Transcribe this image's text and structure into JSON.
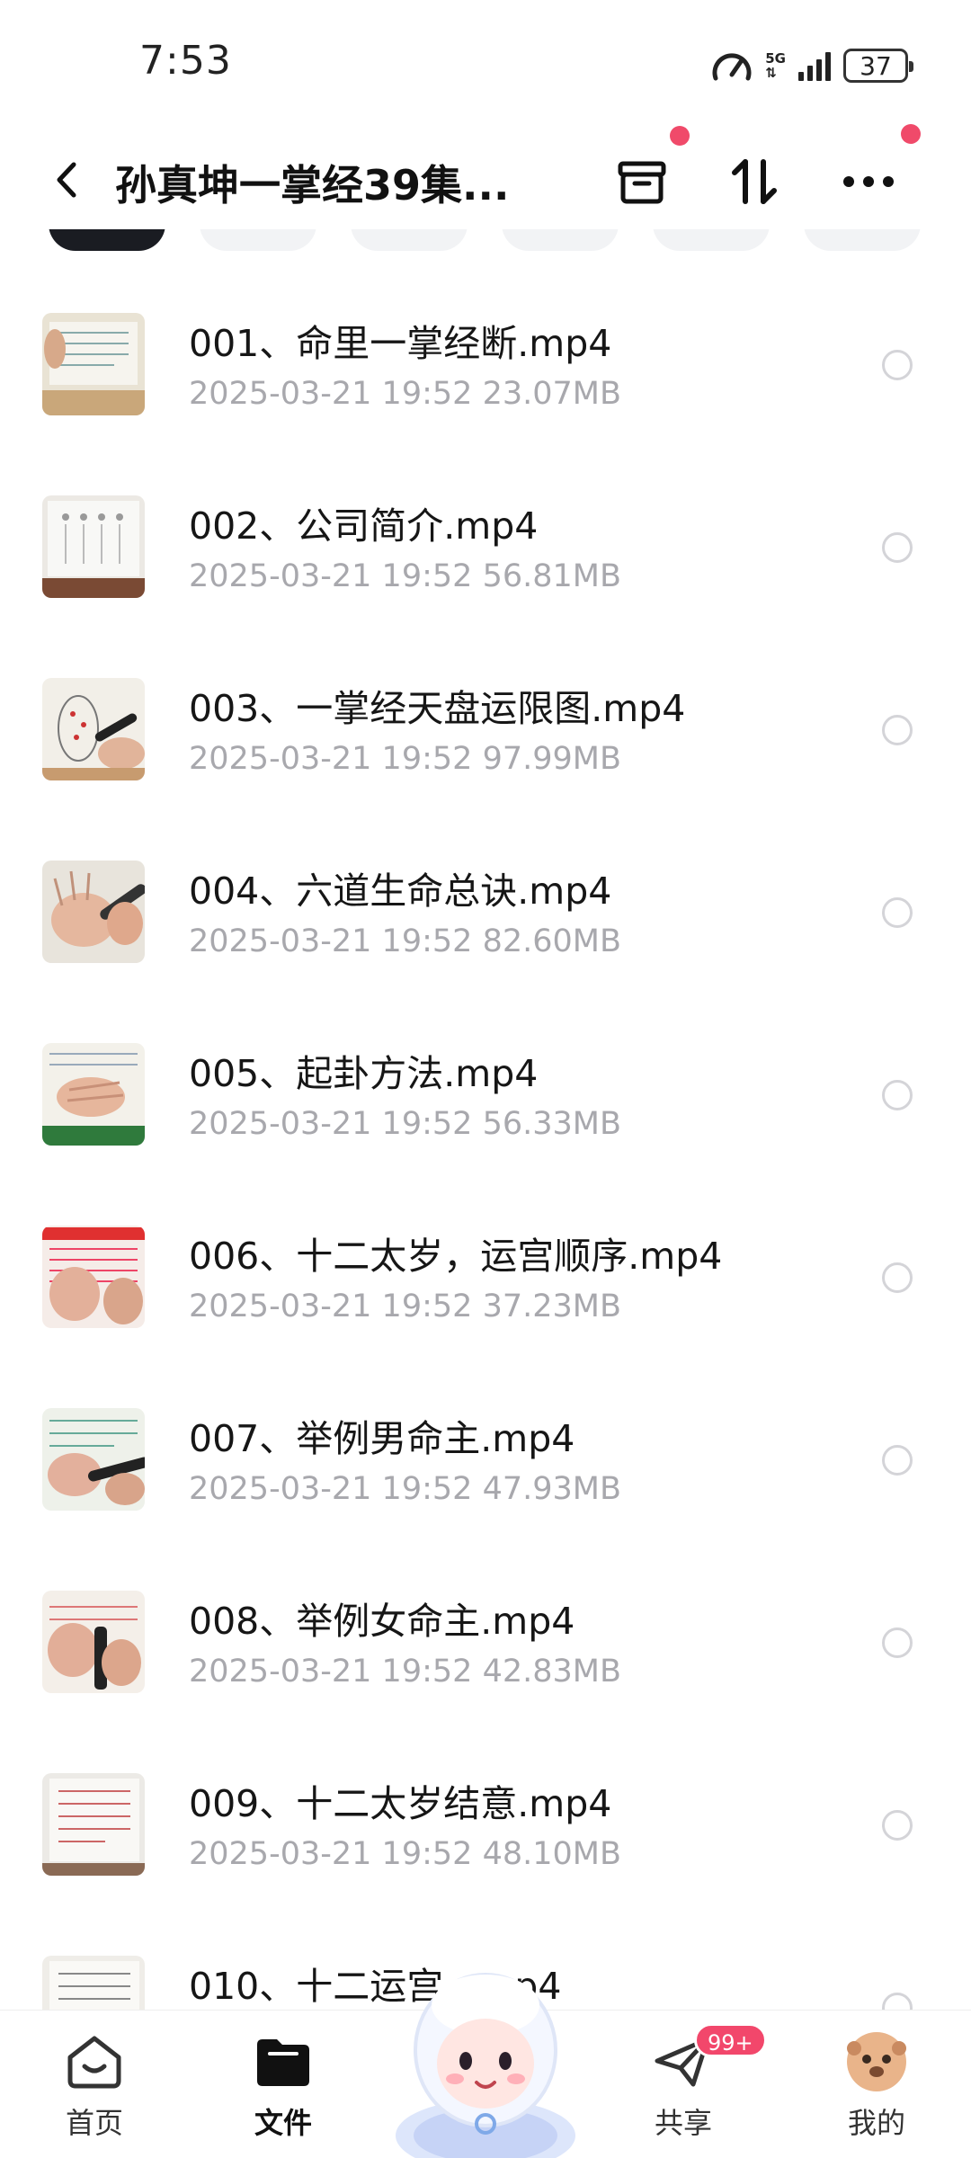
{
  "status_bar": {
    "time": "7:53",
    "network": "5G",
    "battery": "37"
  },
  "header": {
    "title": "孙真坤一掌经39集..."
  },
  "files": [
    {
      "name": "001、命里一掌经断.mp4",
      "date": "2025-03-21",
      "time": "19:52",
      "size": "23.07MB"
    },
    {
      "name": "002、公司简介.mp4",
      "date": "2025-03-21",
      "time": "19:52",
      "size": "56.81MB"
    },
    {
      "name": "003、一掌经天盘运限图.mp4",
      "date": "2025-03-21",
      "time": "19:52",
      "size": "97.99MB"
    },
    {
      "name": "004、六道生命总诀.mp4",
      "date": "2025-03-21",
      "time": "19:52",
      "size": "82.60MB"
    },
    {
      "name": "005、起卦方法.mp4",
      "date": "2025-03-21",
      "time": "19:52",
      "size": "56.33MB"
    },
    {
      "name": "006、十二太岁，运宫顺序.mp4",
      "date": "2025-03-21",
      "time": "19:52",
      "size": "37.23MB"
    },
    {
      "name": "007、举例男命主.mp4",
      "date": "2025-03-21",
      "time": "19:52",
      "size": "47.93MB"
    },
    {
      "name": "008、举例女命主.mp4",
      "date": "2025-03-21",
      "time": "19:52",
      "size": "42.83MB"
    },
    {
      "name": "009、十二太岁结意.mp4",
      "date": "2025-03-21",
      "time": "19:52",
      "size": "48.10MB"
    },
    {
      "name": "010、十二运宫...mp4",
      "date": "",
      "time": "",
      "size": ""
    }
  ],
  "bottom_nav": [
    {
      "label": "首页",
      "icon": "home-icon"
    },
    {
      "label": "文件",
      "icon": "folder-icon"
    },
    {
      "label": "共享",
      "icon": "paper-plane-icon",
      "badge": "99+"
    },
    {
      "label": "我的",
      "icon": "avatar-icon"
    }
  ],
  "colors": {
    "accent_red": "#f04a6a",
    "meta_gray": "#a8a8ad",
    "dark": "#1a1c22"
  }
}
